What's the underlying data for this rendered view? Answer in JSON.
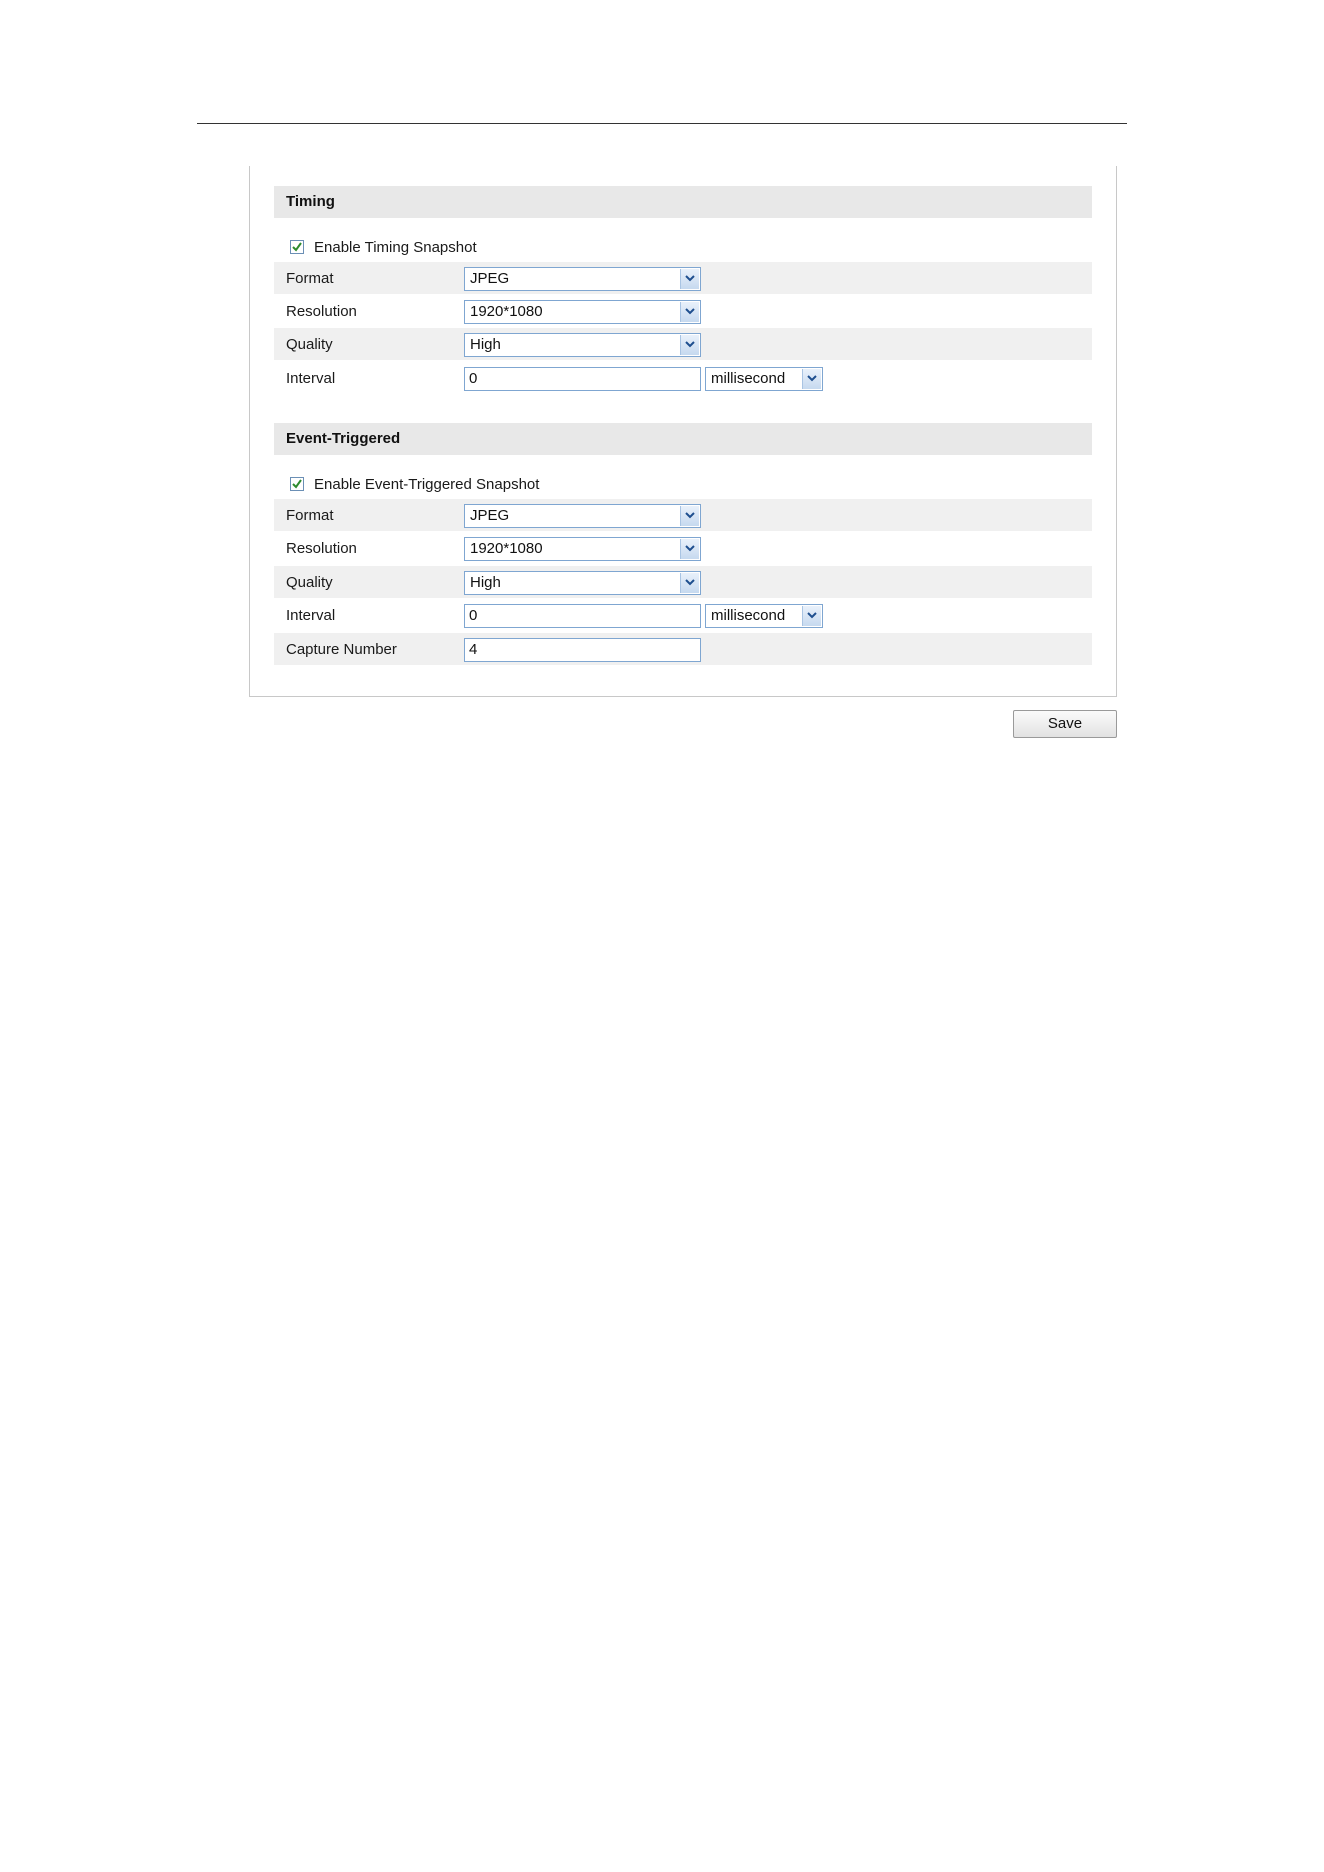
{
  "timing": {
    "title": "Timing",
    "enable_label": "Enable Timing Snapshot",
    "enable_checked": true,
    "format": {
      "label": "Format",
      "value": "JPEG"
    },
    "resolution": {
      "label": "Resolution",
      "value": "1920*1080"
    },
    "quality": {
      "label": "Quality",
      "value": "High"
    },
    "interval": {
      "label": "Interval",
      "value": "0",
      "unit": "millisecond"
    }
  },
  "event": {
    "title": "Event-Triggered",
    "enable_label": "Enable Event-Triggered Snapshot",
    "enable_checked": true,
    "format": {
      "label": "Format",
      "value": "JPEG"
    },
    "resolution": {
      "label": "Resolution",
      "value": "1920*1080"
    },
    "quality": {
      "label": "Quality",
      "value": "High"
    },
    "interval": {
      "label": "Interval",
      "value": "0",
      "unit": "millisecond"
    },
    "capture_number": {
      "label": "Capture Number",
      "value": "4"
    }
  },
  "actions": {
    "save_label": "Save"
  },
  "colors": {
    "section_header_bg": "#e8e8e8",
    "shaded_row_bg": "#f0f0f0",
    "input_border": "#7fa6d1",
    "checkmark": "#2e8b2e"
  },
  "icons": {
    "checkbox_check": "checkmark-icon",
    "dropdown_arrow": "chevron-down-icon"
  }
}
